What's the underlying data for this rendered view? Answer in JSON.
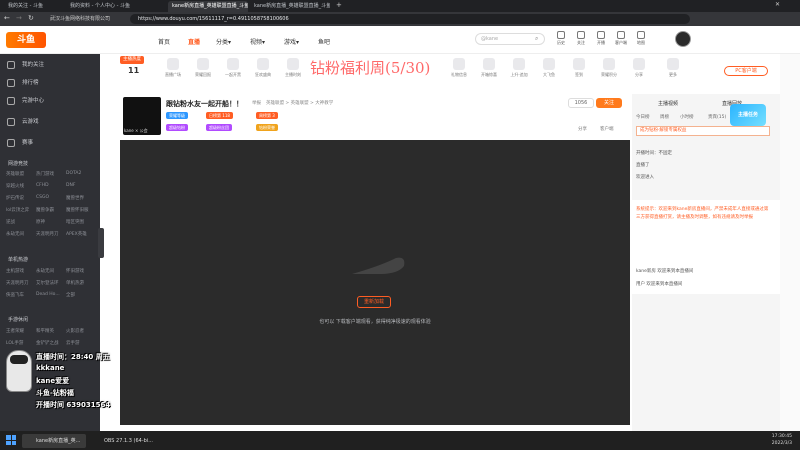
{
  "browser": {
    "tabs": [
      {
        "label": "我的关注 - 斗鱼",
        "active": false
      },
      {
        "label": "我的资料 - 个人中心 - 斗鱼",
        "active": false
      },
      {
        "label": "kane新房直播_英雄联盟直播_斗鱼直播",
        "active": true
      },
      {
        "label": "kane新房直播_英雄联盟直播_斗鱼直播",
        "active": false
      }
    ],
    "site_badge": "武汉斗鱼网络科技有限公司",
    "url": "https://www.douyu.com/15611117_r=0.4911058758100606",
    "colors": {
      "accent": "#ff5d23",
      "dark_bg": "#202124"
    }
  },
  "header": {
    "logo": "斗鱼",
    "nav": [
      "首页",
      "直播",
      "分类▾",
      "视频▾",
      "游戏▾",
      "鱼吧"
    ],
    "search_placeholder": "@kane",
    "icons": [
      {
        "name": "history-icon",
        "label": "历史"
      },
      {
        "name": "follow-icon",
        "label": "关注"
      },
      {
        "name": "live-icon",
        "label": "开播"
      },
      {
        "name": "message-icon",
        "label": "客户端"
      },
      {
        "name": "location-icon",
        "label": "地图"
      }
    ]
  },
  "sidebar": {
    "items": [
      {
        "label": "我的关注",
        "icon": "heart-icon"
      },
      {
        "label": "排行榜",
        "icon": "rank-icon"
      },
      {
        "label": "完游中心",
        "icon": "game-center-icon"
      },
      {
        "label": "云游戏",
        "icon": "cloud-icon"
      },
      {
        "label": "赛事",
        "icon": "trophy-icon"
      }
    ],
    "sections": [
      {
        "title": "网游竞技",
        "links": [
          "英雄联盟",
          "热门游戏",
          "DOTA2",
          "穿越火线",
          "CFHD",
          "DNF",
          "炉石传说",
          "CSGO",
          "魔兽世界",
          "lol云顶之弈",
          "魔兽争霸",
          "魔兽怀旧服",
          "逆战",
          "原神",
          "暗区突围",
          "永劫无间",
          "天涯明月刀",
          "APEX英雄"
        ]
      },
      {
        "title": "单机热游",
        "links": [
          "主机游戏",
          "永劫无间",
          "怀旧游戏",
          "天涯明月刀",
          "艾尔登法环",
          "单机热游",
          "俠盗飞车",
          "Dead Ho...",
          "全部"
        ]
      },
      {
        "title": "手游休闲",
        "links": [
          "王者荣耀",
          "和平精英",
          "火影忍者",
          "LOL手游",
          "金铲铲之战",
          "云手游"
        ]
      }
    ]
  },
  "topbar": {
    "tag": "主播热度",
    "count": "11",
    "gifts": [
      "直播广场",
      "荣耀回报",
      "一起开黑",
      "狂欢盛典",
      "主播时刻",
      "发布计划",
      "火力全开",
      "闪电之声",
      "狂欢盛典",
      "礼物信息",
      "开箱惊喜",
      "上升·追加",
      "大飞鱼",
      "签到",
      "荣耀积分",
      "分享",
      "更多"
    ],
    "banner": "钻粉福利周(5/30)",
    "pc_button": "PC客户端"
  },
  "room": {
    "title": "跟钻粉水友一起开船！！",
    "meta": [
      "举报",
      "英雄联盟 > 英雄联盟 > 大神教学"
    ],
    "tags": [
      {
        "label": "荣耀等级",
        "color": "#2d97ff"
      },
      {
        "label": "日榜第 118",
        "color": "#ff5d23"
      },
      {
        "label": "周榜第 3",
        "color": "#ff5d23"
      },
      {
        "label": "超级钻粉",
        "color": "#b14bff"
      },
      {
        "label": "超级粉丝团",
        "color": "#b14bff"
      },
      {
        "label": "钻粉荣誉",
        "color": "#f0a31c"
      }
    ],
    "avatar_caption": "kane × 公会",
    "followers": "1056",
    "follow_button": "关注",
    "tools": [
      "分享",
      "客户端"
    ],
    "offline_button": "重新加载",
    "offline_text": "也可以 下载客户端观看，获得纯净极速的观看体验"
  },
  "right_panel": {
    "tabs": [
      "主播视频",
      "直播回放",
      "活动",
      "贡献榜"
    ],
    "subtabs": [
      "今日榜",
      "周榜",
      "小时榜",
      "贵宾(15)",
      "粉丝团"
    ],
    "notice": "开播时间：不固定\n直播了\n欢迎进入",
    "chat": [
      {
        "text": "系统提示：欢迎来到kane新房直播间，严禁未成年人直接或通过第三方获得直播打赏，请主播及时调整，如有违规请及时举报",
        "sys": true
      },
      {
        "text": "kane新房  欢迎来到本直播间",
        "sys": false
      },
      {
        "text": "用户  欢迎来到本直播间",
        "sys": false
      }
    ]
  },
  "overlay": {
    "lines": [
      "直播时间：28:40 周五",
      "kkkane",
      "kane爱爱",
      "斗鱼-钻粉福",
      "开播时间 639031564"
    ]
  },
  "taskbar": {
    "apps": [
      "kane新房直播_英...",
      "OBS 27.1.3 (64-bi..."
    ],
    "time": "17:30:45",
    "date": "2022/3/3"
  }
}
